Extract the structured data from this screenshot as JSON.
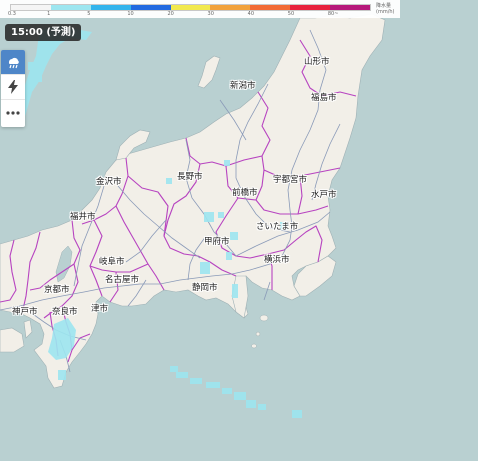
{
  "time_badge": "15:00 (予測)",
  "legend": {
    "unit_title": "降水量",
    "unit": "(mm/h)",
    "ticks": [
      "0.3",
      "1",
      "5",
      "10",
      "20",
      "30",
      "40",
      "50",
      "80~"
    ],
    "colors": [
      "#f5f5f5",
      "#9de6f0",
      "#33b4ec",
      "#2169e0",
      "#f2e94d",
      "#f2a23c",
      "#f26a34",
      "#e8223e",
      "#b6187b"
    ]
  },
  "toolbar": {
    "buttons": [
      {
        "name": "rain",
        "icon": "cloud-rain-icon",
        "active": true
      },
      {
        "name": "lightning",
        "icon": "lightning-icon",
        "active": false
      },
      {
        "name": "more",
        "icon": "more-dots-icon",
        "active": false
      }
    ]
  },
  "map": {
    "cities": [
      "山形市",
      "新潟市",
      "福島市",
      "長野市",
      "宇都宮市",
      "金沢市",
      "前橋市",
      "水戸市",
      "福井市",
      "さいたま市",
      "甲府市",
      "横浜市",
      "岐阜市",
      "名古屋市",
      "静岡市",
      "京都市",
      "津市",
      "神戸市",
      "奈良市"
    ],
    "colors": {
      "sea": "#b9d0d1",
      "land": "#f2efe8",
      "prefecture_border": "#b743c0",
      "road": "#8a9ab8",
      "rain_light": "#9de6f0"
    }
  }
}
